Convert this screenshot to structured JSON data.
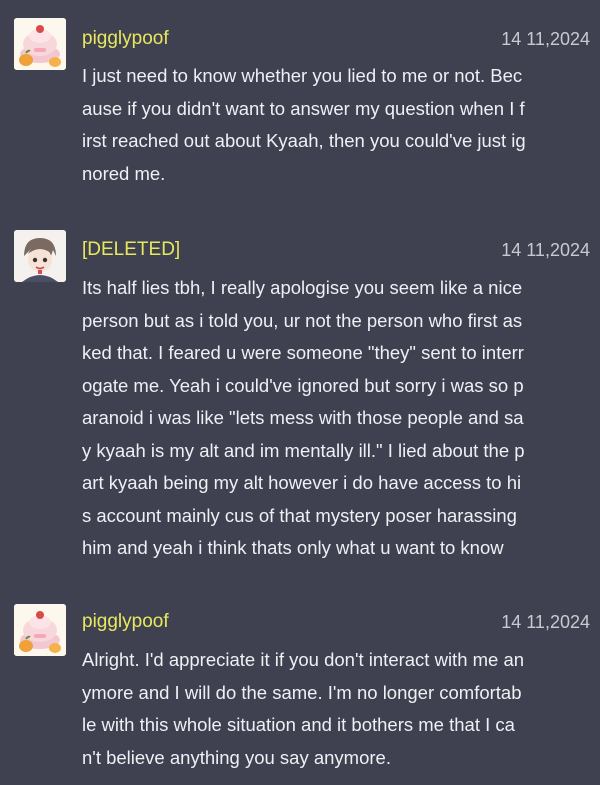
{
  "messages": [
    {
      "username": "pigglypoof",
      "timestamp": "14 11,2024",
      "avatar_icon": "pumpkin-cake-avatar-icon",
      "lines": [
        "I just need to know whether you lied to me or not. Bec",
        "ause if you didn't want to answer my question when I f",
        "irst reached out about Kyaah, then you could've just ig",
        "nored me."
      ]
    },
    {
      "username": "[DELETED]",
      "timestamp": "14 11,2024",
      "avatar_icon": "anime-character-avatar-icon",
      "lines": [
        "Its half lies tbh, I really apologise you seem like a nice",
        "person but as i told you, ur not the person who first as",
        "ked that. I feared u were someone \"they\" sent to interr",
        "ogate me. Yeah i could've ignored but sorry i was so p",
        "aranoid i was like \"lets mess with those people and sa",
        "y kyaah is my alt and im mentally ill.\" I lied about the p",
        "art kyaah being my alt however i do have access to hi",
        "s account mainly cus of that mystery poser harassing",
        "him and yeah i think thats only what u want to know"
      ]
    },
    {
      "username": "pigglypoof",
      "timestamp": "14 11,2024",
      "avatar_icon": "pumpkin-cake-avatar-icon",
      "lines": [
        "Alright. I'd appreciate it if you don't interact with me an",
        "ymore and I will do the same. I'm no longer comfortab",
        "le with this whole situation and it bothers me that I ca",
        "n't believe anything you say anymore."
      ]
    }
  ]
}
